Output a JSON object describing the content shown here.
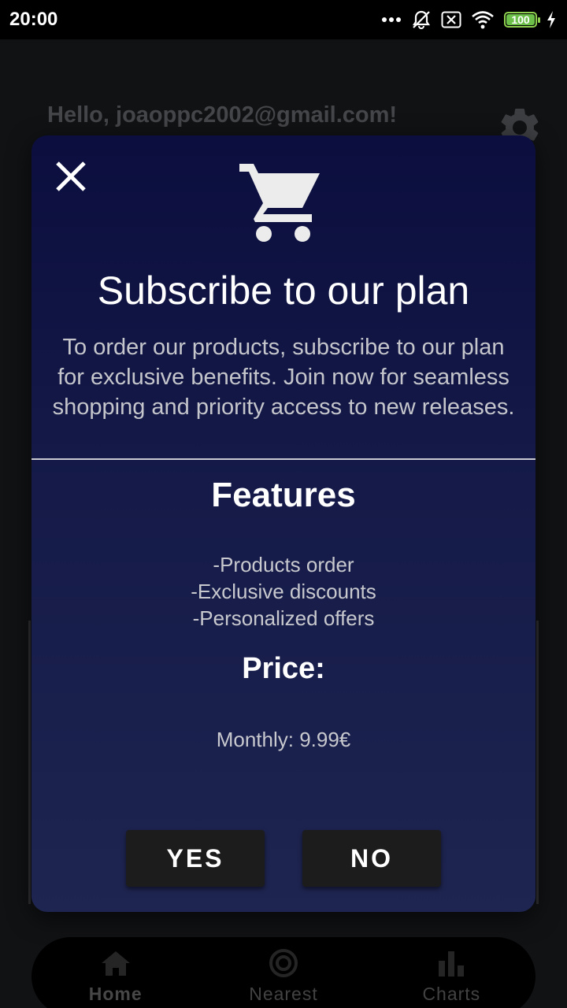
{
  "status_bar": {
    "time": "20:00",
    "battery_level": "100",
    "battery_percent": 100
  },
  "header": {
    "greeting": "Hello, joaoppc2002@gmail.com!"
  },
  "modal": {
    "title": "Subscribe to our plan",
    "description": "To order our products, subscribe to our plan for exclusive benefits. Join now for seamless shopping and priority access to new releases.",
    "features_title": "Features",
    "features": [
      "-Products order",
      "-Exclusive discounts",
      "-Personalized offers"
    ],
    "price_title": "Price:",
    "price_value": "Monthly: 9.99€",
    "yes_label": "YES",
    "no_label": "NO"
  },
  "bottom_nav": {
    "items": [
      {
        "label": "Home",
        "icon": "home-icon",
        "active": true
      },
      {
        "label": "Nearest",
        "icon": "target-icon",
        "active": false
      },
      {
        "label": "Charts",
        "icon": "bar-chart-icon",
        "active": false
      }
    ]
  },
  "colors": {
    "modal_top": "#0b0e3e",
    "modal_bottom": "#1e2550",
    "button_bg": "#1c1c1c",
    "battery": "#6cc04a"
  }
}
